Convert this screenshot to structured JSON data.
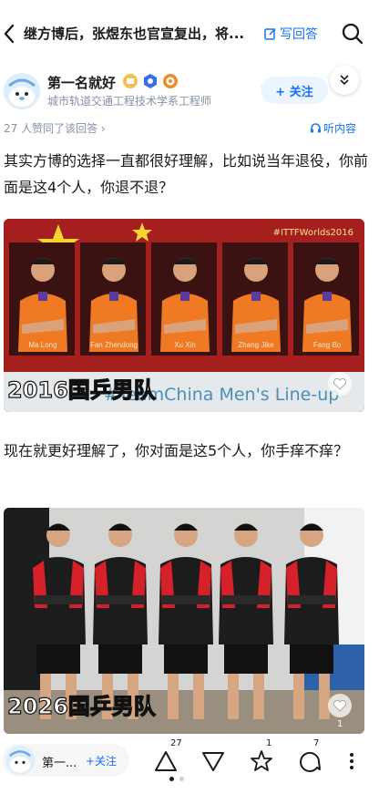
{
  "header": {
    "question_title": "继方博后，张煜东也官宣复出，将...",
    "write_answer_label": "写回答"
  },
  "author": {
    "name": "第一名就好",
    "bio": "城市轨道交通工程技术学系工程师",
    "follow_label": "+ 关注"
  },
  "meta": {
    "agree_text": "27 人赞同了该回答 ›",
    "listen_label": "听内容"
  },
  "content": {
    "paragraph_1": "其实方博的选择一直都很好理解，比如说当年退役，你前面是这4个人，你退不退？",
    "paragraph_2": "现在就更好理解了，你对面是这5个人，你手痒不痒？"
  },
  "image_1": {
    "hashtag": "#ITTFWorlds2016",
    "caption": "2016国乒男队",
    "subcaption": "#TeamChina Men's Line-up",
    "players": [
      "Ma Long",
      "Fan Zhendong",
      "Xu Xin",
      "Zhang Jike",
      "Fang Bo"
    ]
  },
  "image_2": {
    "caption": "2026国乒男队",
    "like_count": "1"
  },
  "bottom_bar": {
    "author_short": "第一...",
    "follow_label": "+关注",
    "upvote_count": "27",
    "like_count": "1",
    "comment_count": "7"
  },
  "colors": {
    "accent": "#1772f6",
    "muted": "#8590a6"
  }
}
